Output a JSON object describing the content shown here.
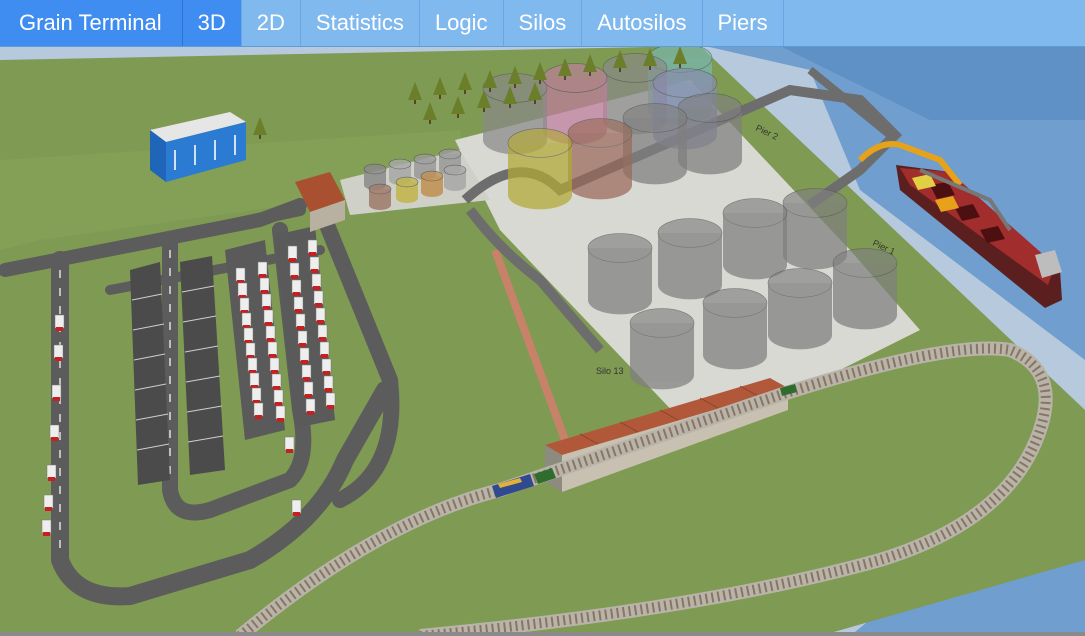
{
  "app": {
    "title": "Grain Terminal"
  },
  "tabs": [
    {
      "label": "3D",
      "active": true
    },
    {
      "label": "2D",
      "active": false
    },
    {
      "label": "Statistics",
      "active": false
    },
    {
      "label": "Logic",
      "active": false
    },
    {
      "label": "Silos",
      "active": false
    },
    {
      "label": "Autosilos",
      "active": false
    },
    {
      "label": "Piers",
      "active": false
    }
  ],
  "scene": {
    "labels": {
      "pier_1": "Pier 1",
      "pier_2": "Pier 2",
      "silo_13": "Silo 13"
    },
    "colors": {
      "water": "#6f9ecf",
      "ground": "#7f9a52",
      "concrete": "#d9d9d3",
      "road": "#5f5f5f",
      "accent": "#3f8df0"
    }
  }
}
